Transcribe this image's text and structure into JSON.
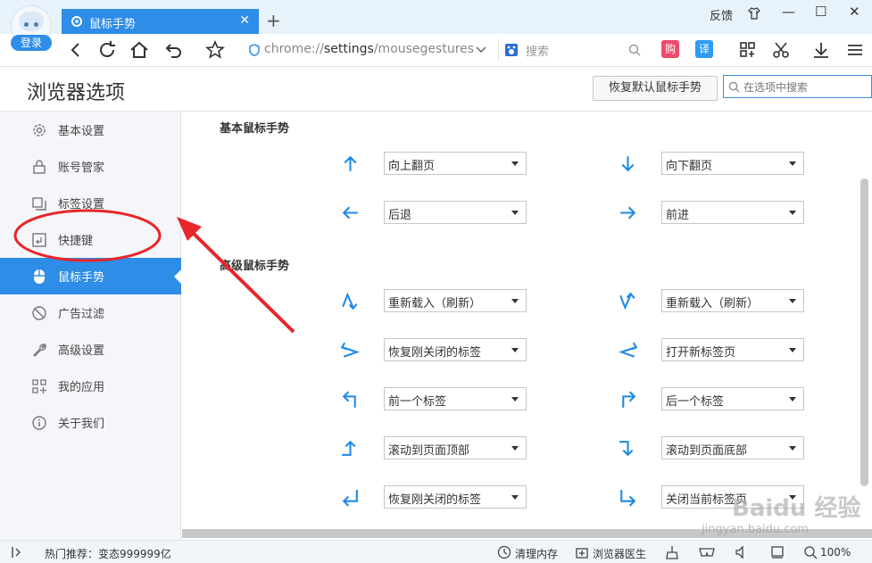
{
  "colors": {
    "accent": "#2e8de6",
    "annotation": "#e8262b",
    "gesture_arrow": "#1f8ae6"
  },
  "titlebar": {
    "login_label": "登录",
    "tab_title": "鼠标手势",
    "tab_close": "✕",
    "new_tab": "+",
    "feedback": "反馈",
    "min": "—",
    "max": "☐",
    "close": "✕"
  },
  "navbar": {
    "url_prefix": "chrome://",
    "url_main": "settings",
    "url_suffix": "/mousegestures",
    "search_placeholder": "搜索",
    "ext_buy": "购",
    "ext_translate": "译"
  },
  "header": {
    "title": "浏览器选项",
    "restore_button": "恢复默认鼠标手势",
    "search_placeholder": "在选项中搜索"
  },
  "sidebar": {
    "items": [
      {
        "label": "基本设置",
        "icon": "gear-icon"
      },
      {
        "label": "账号管家",
        "icon": "lock-icon"
      },
      {
        "label": "标签设置",
        "icon": "tabs-icon"
      },
      {
        "label": "快捷键",
        "icon": "keyboard-icon"
      },
      {
        "label": "鼠标手势",
        "icon": "mouse-icon",
        "active": true
      },
      {
        "label": "广告过滤",
        "icon": "block-icon"
      },
      {
        "label": "高级设置",
        "icon": "wrench-icon"
      },
      {
        "label": "我的应用",
        "icon": "apps-icon"
      },
      {
        "label": "关于我们",
        "icon": "info-icon"
      }
    ]
  },
  "main": {
    "basic_title": "基本鼠标手势",
    "advanced_title": "高级鼠标手势",
    "basic": [
      {
        "left": "向上翻页",
        "right": "向下翻页"
      },
      {
        "left": "后退",
        "right": "前进"
      }
    ],
    "advanced": [
      {
        "left": "重新载入（刷新）",
        "right": "重新载入（刷新）"
      },
      {
        "left": "恢复刚关闭的标签",
        "right": "打开新标签页"
      },
      {
        "left": "前一个标签",
        "right": "后一个标签"
      },
      {
        "left": "滚动到页面顶部",
        "right": "滚动到页面底部"
      },
      {
        "left": "恢复刚关闭的标签",
        "right": "关闭当前标签页"
      }
    ]
  },
  "statusbar": {
    "hot": "热门推荐：变态999999亿",
    "clean_memory": "清理内存",
    "doctor": "浏览器医生",
    "zoom": "100%"
  },
  "watermark": {
    "brand": "Baidu 经验",
    "url": "jingyan.baidu.com"
  }
}
